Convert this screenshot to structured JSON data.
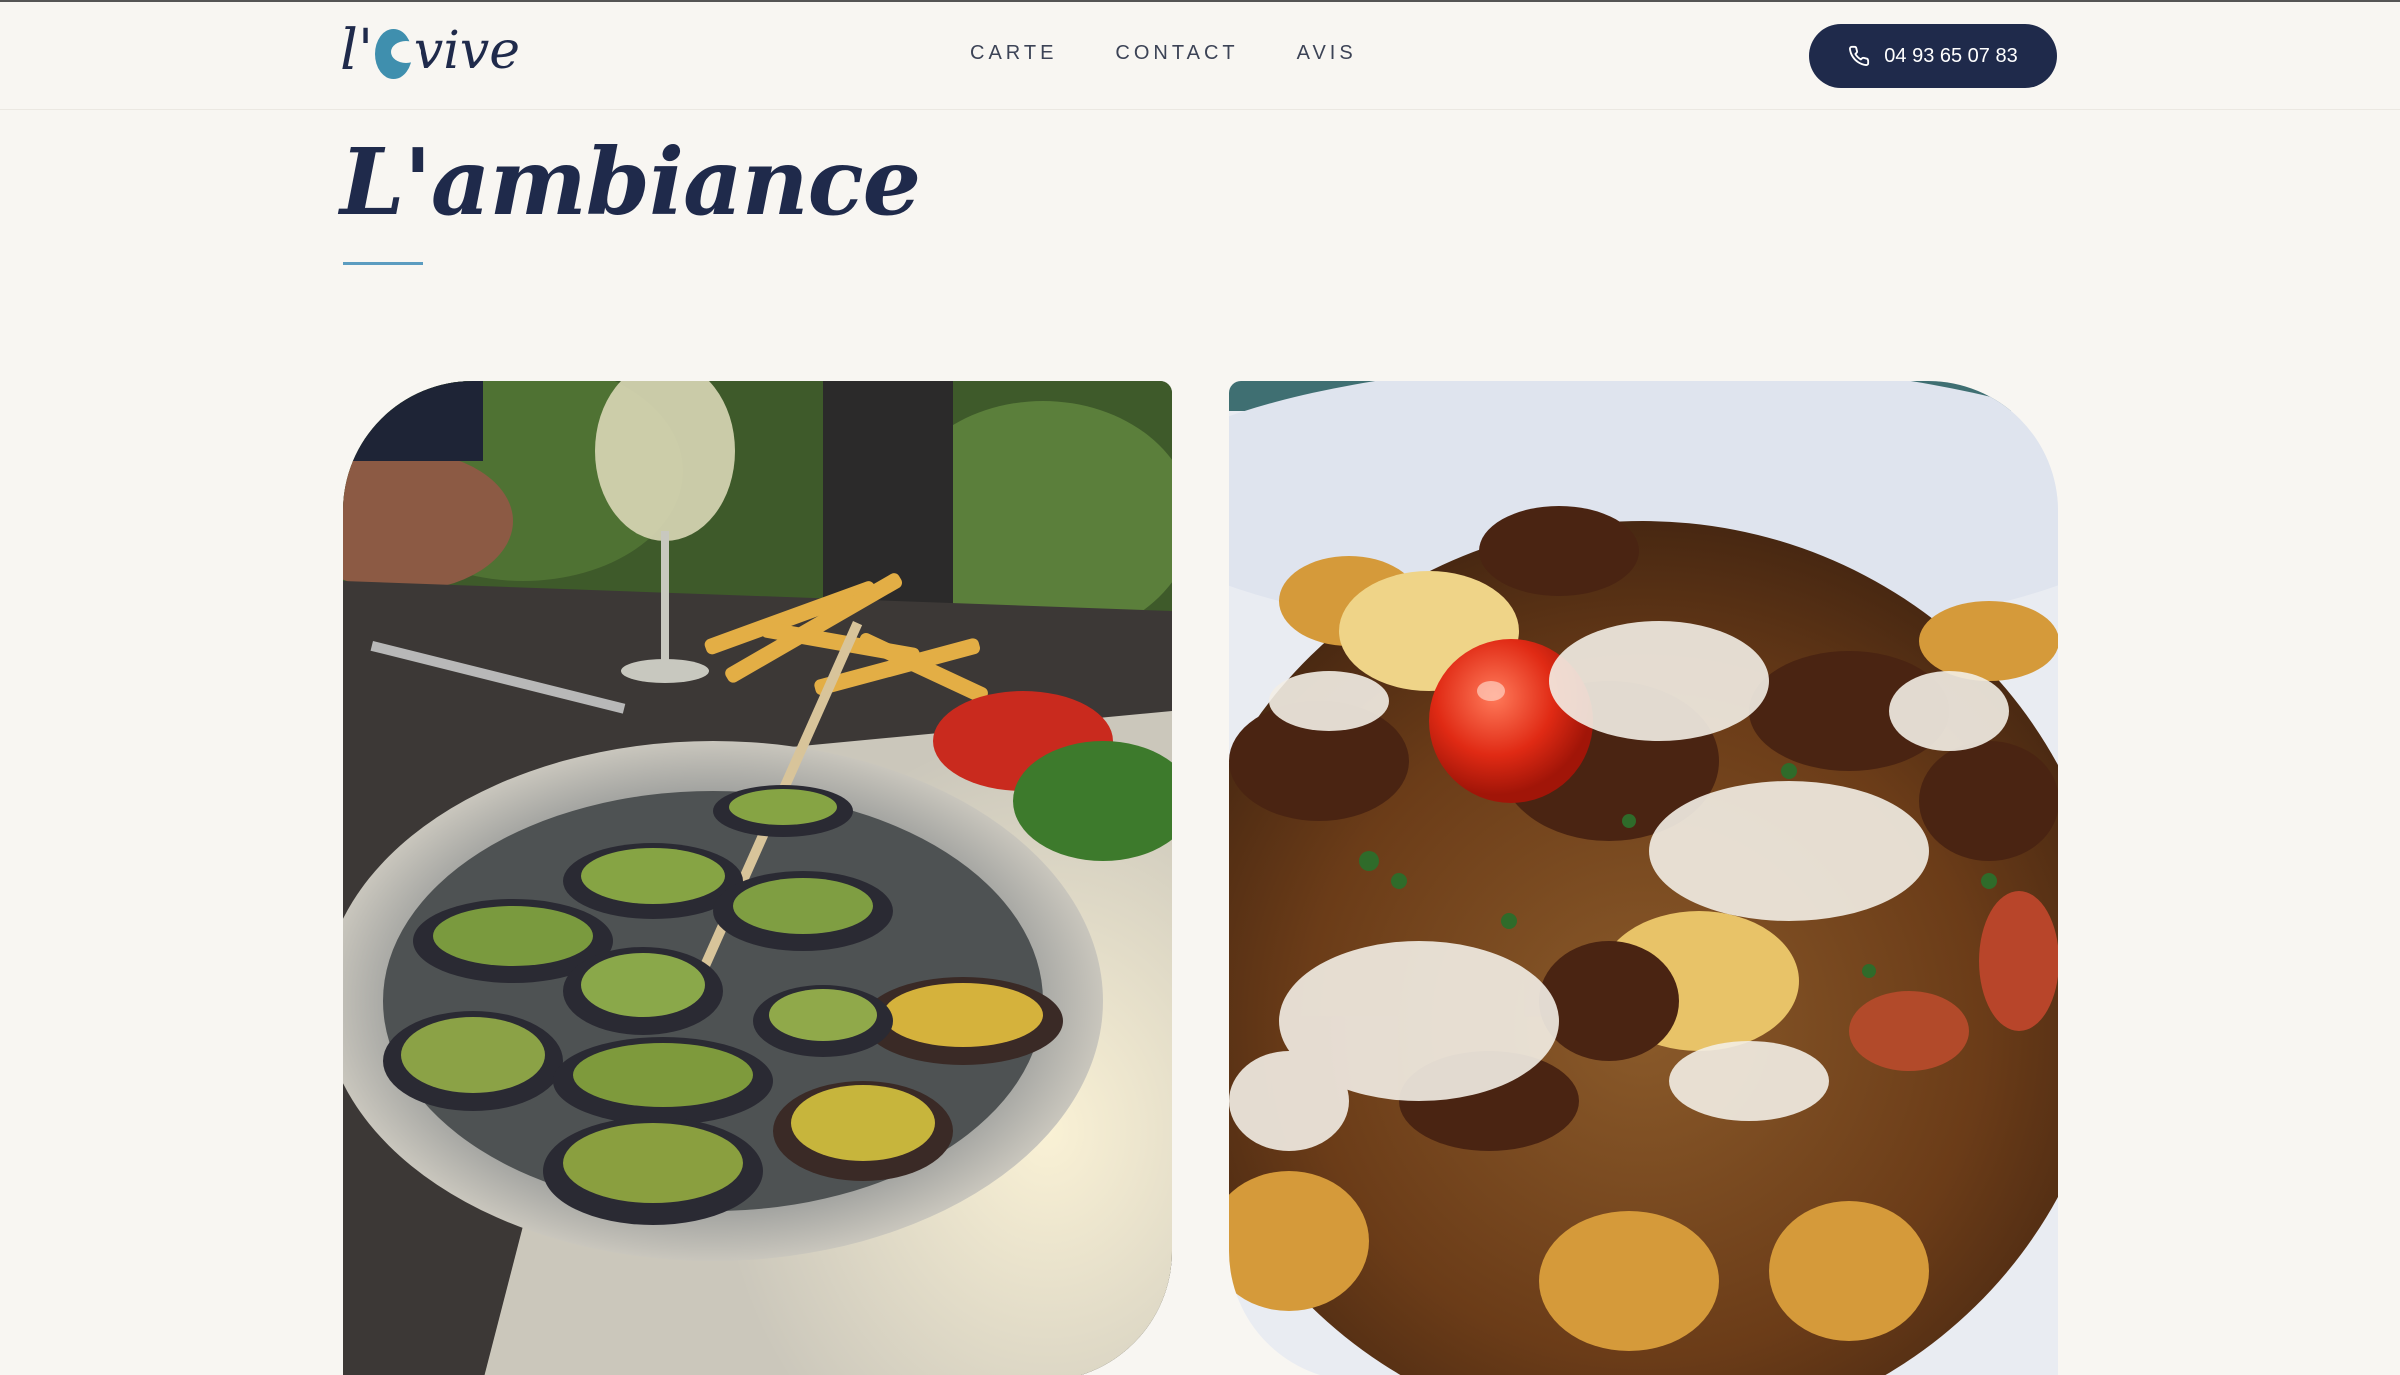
{
  "header": {
    "logo_text": "l'ovive",
    "nav": [
      "CARTE",
      "CONTACT",
      "AVIS"
    ],
    "phone_label": "04 93 65 07 83",
    "phone_icon": "phone-icon"
  },
  "section": {
    "title": "L'ambiance"
  },
  "colors": {
    "brand_navy": "#1f2a4b",
    "accent_blue": "#5b9cc0",
    "background": "#f8f6f2"
  }
}
